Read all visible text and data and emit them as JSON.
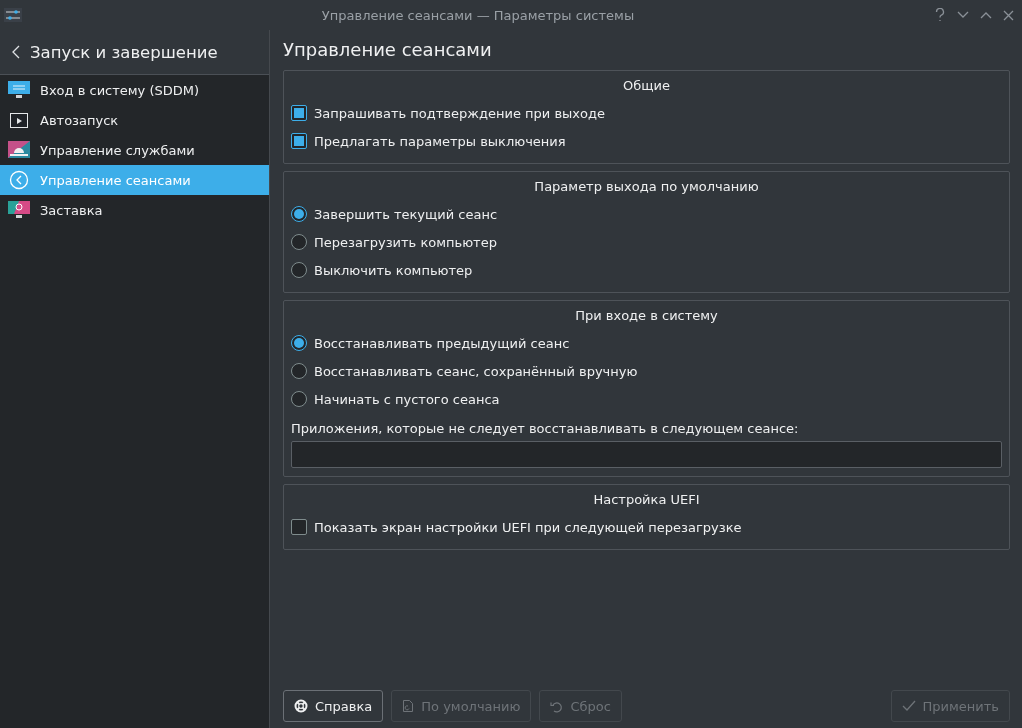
{
  "window": {
    "title": "Управление сеансами — Параметры системы"
  },
  "sidebar": {
    "back_title": "Запуск и завершение",
    "items": [
      {
        "label": "Вход в систему (SDDM)",
        "kind": "monitor",
        "selected": false
      },
      {
        "label": "Автозапуск",
        "kind": "play",
        "selected": false
      },
      {
        "label": "Управление службами",
        "kind": "services",
        "selected": false
      },
      {
        "label": "Управление сеансами",
        "kind": "session",
        "selected": true
      },
      {
        "label": "Заставка",
        "kind": "screen",
        "selected": false
      }
    ]
  },
  "page_title": "Управление сеансами",
  "groups": [
    {
      "title": "Общие",
      "options": [
        {
          "kind": "checkbox",
          "label": "Запрашивать подтверждение при выходе",
          "checked": true
        },
        {
          "kind": "checkbox",
          "label": "Предлагать параметры выключения",
          "checked": true
        }
      ]
    },
    {
      "title": "Параметр выхода по умолчанию",
      "options": [
        {
          "kind": "radio",
          "label": "Завершить текущий сеанс",
          "checked": true
        },
        {
          "kind": "radio",
          "label": "Перезагрузить компьютер",
          "checked": false
        },
        {
          "kind": "radio",
          "label": "Выключить компьютер",
          "checked": false
        }
      ]
    },
    {
      "title": "При входе в систему",
      "options": [
        {
          "kind": "radio",
          "label": "Восстанавливать предыдущий сеанс",
          "checked": true
        },
        {
          "kind": "radio",
          "label": "Восстанавливать сеанс, сохранённый вручную",
          "checked": false
        },
        {
          "kind": "radio",
          "label": "Начинать с пустого сеанса",
          "checked": false
        }
      ],
      "field": {
        "label": "Приложения, которые не следует восстанавливать в следующем сеансе:"
      }
    },
    {
      "title": "Настройка UEFI",
      "options": [
        {
          "kind": "checkbox",
          "label": "Показать экран настройки UEFI при следующей перезагрузке",
          "checked": false
        }
      ]
    }
  ],
  "buttons": [
    {
      "label": "Справка",
      "kind": "help",
      "disabled": false
    },
    {
      "label": "По умолчанию",
      "kind": "defaults",
      "disabled": true
    },
    {
      "label": "Сброс",
      "kind": "reset",
      "disabled": true
    },
    {
      "label": "Применить",
      "kind": "apply",
      "disabled": true
    }
  ]
}
